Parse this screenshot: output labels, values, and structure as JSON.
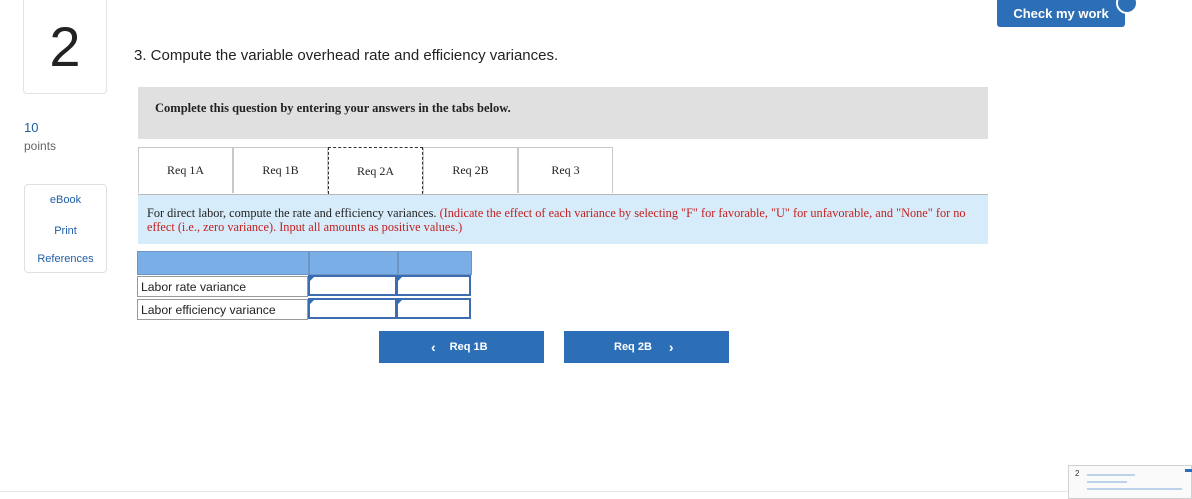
{
  "header": {
    "check_label": "Check my work"
  },
  "question_number": "2",
  "points": {
    "value": "10",
    "label": "points"
  },
  "tools": {
    "items": [
      "eBook",
      "Print",
      "References"
    ]
  },
  "question": {
    "text": "3. Compute the variable overhead rate and efficiency variances."
  },
  "banner": {
    "text": "Complete this question by entering your answers in the tabs below."
  },
  "tabs": [
    {
      "label": "Req 1A"
    },
    {
      "label": "Req 1B"
    },
    {
      "label": "Req 2A"
    },
    {
      "label": "Req 2B"
    },
    {
      "label": "Req 3"
    }
  ],
  "active_tab": "Req 2A",
  "instruction": {
    "main": "For direct labor, compute the rate and efficiency variances.",
    "note": "(Indicate the effect of each variance by selecting \"F\" for favorable, \"U\" for unfavorable, and \"None\" for no effect (i.e., zero variance). Input all amounts as positive values.)"
  },
  "table": {
    "rows": [
      {
        "label": "Labor rate variance",
        "amount": "",
        "effect": ""
      },
      {
        "label": "Labor efficiency variance",
        "amount": "",
        "effect": ""
      }
    ]
  },
  "nav": {
    "prev_label": "Req 1B",
    "next_label": "Req 2B"
  },
  "thumbnail": {
    "number": "2"
  },
  "colors": {
    "accent": "#2d6fb7",
    "banner_bg": "#e0e0e0",
    "instruction_bg": "#d6ecfa",
    "note_red": "#c41f1f",
    "grid_header": "#7aaee6"
  }
}
